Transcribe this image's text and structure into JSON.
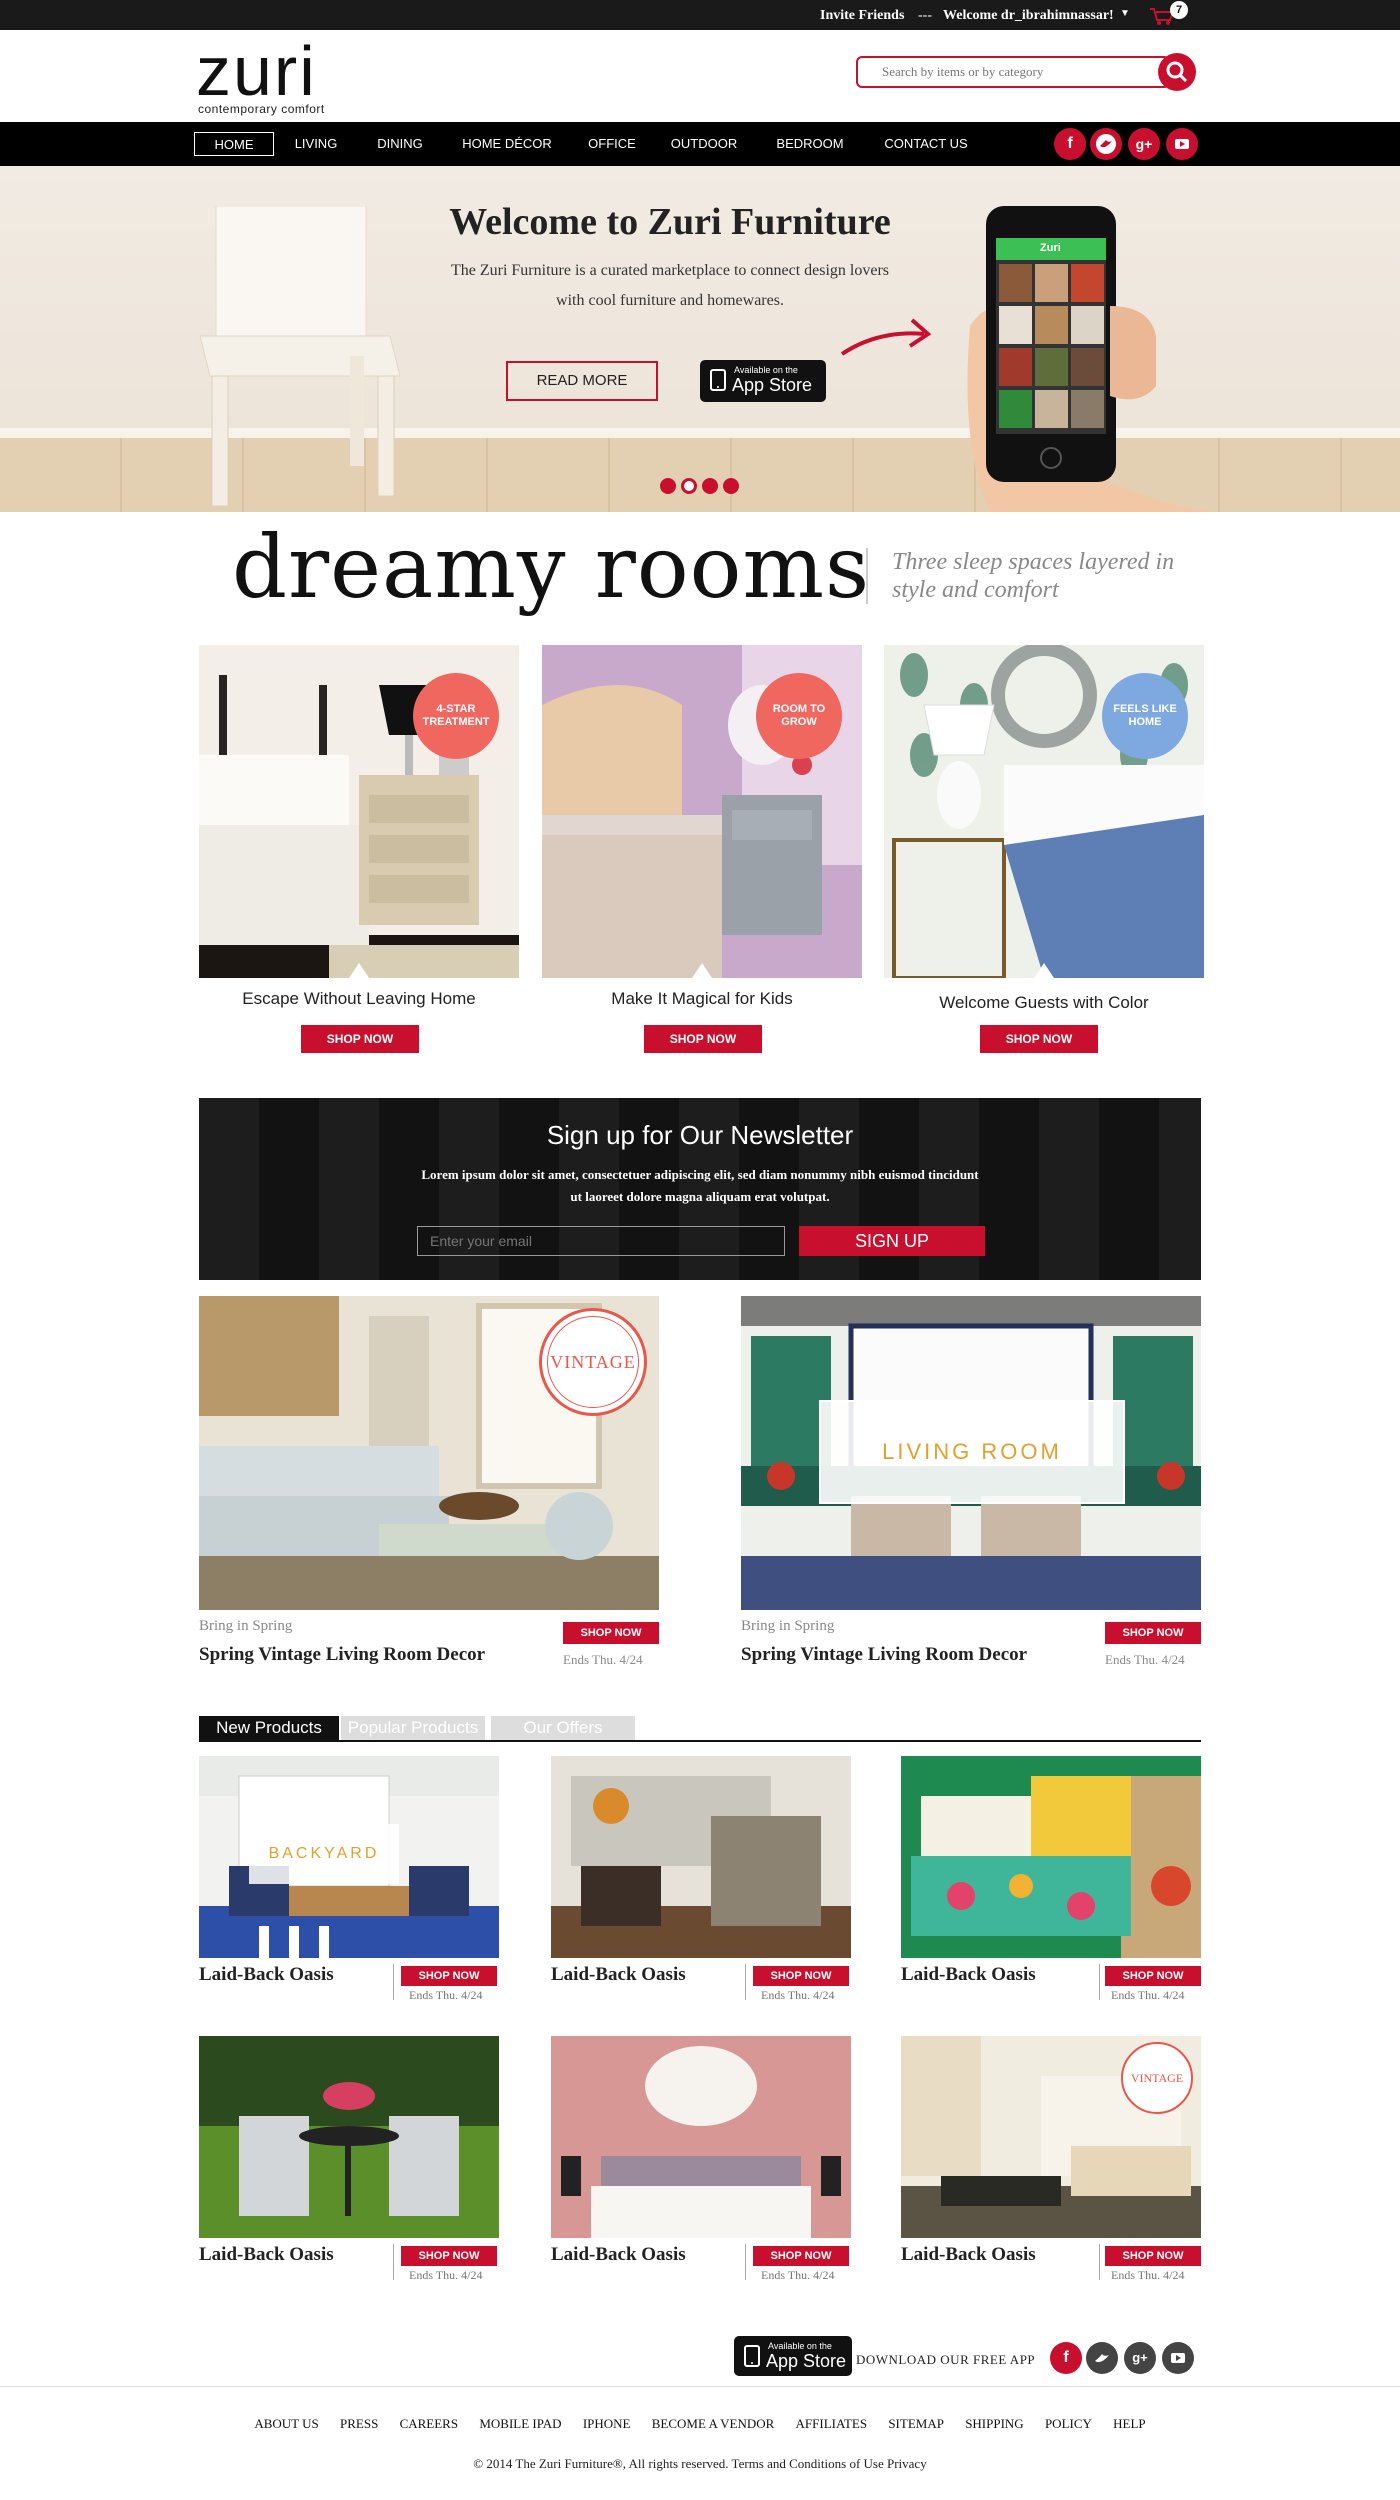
{
  "topbar": {
    "invite": "Invite Friends",
    "separator": "---",
    "welcome": "Welcome dr_ibrahimnassar!",
    "cart_count": "7"
  },
  "header": {
    "logo_word": "zuri",
    "logo_tagline": "contemporary comfort",
    "search_placeholder": "Search by items or by category"
  },
  "nav": {
    "items": [
      "HOME",
      "LIVING",
      "DINING",
      "HOME DÉCOR",
      "OFFICE",
      "OUTDOOR",
      "BEDROOM",
      "CONTACT US"
    ],
    "social": [
      "f",
      "t",
      "g+",
      "yt"
    ]
  },
  "hero": {
    "title": "Welcome to Zuri Furniture",
    "body": "The Zuri Furniture is a curated marketplace to connect design lovers with cool furniture and homewares.",
    "read_more": "READ MORE",
    "appstore_small": "Available on the",
    "appstore_big": "App Store",
    "phone_app_title": "Zuri"
  },
  "dreamy": {
    "title": "dreamy rooms",
    "subtitle": "Three sleep spaces layered in style and comfort"
  },
  "rooms": [
    {
      "badge": "4-STAR TREATMENT",
      "caption": "Escape Without Leaving Home",
      "shop": "SHOP NOW",
      "badge_color": "#f0675f"
    },
    {
      "badge": "ROOM TO GROW",
      "caption": "Make It Magical for Kids",
      "shop": "SHOP NOW",
      "badge_color": "#f0675f"
    },
    {
      "badge": "FEELS LIKE HOME",
      "caption": "Welcome Guests with Color",
      "shop": "SHOP NOW",
      "badge_color": "#7ea8e0"
    }
  ],
  "newsletter": {
    "title": "Sign up for Our Newsletter",
    "body": "Lorem ipsum dolor sit amet, consectetuer adipiscing elit, sed diam nonummy nibh euismod tincidunt ut laoreet dolore magna aliquam erat volutpat.",
    "placeholder": "Enter your email",
    "button": "SIGN UP"
  },
  "features": [
    {
      "badge": "VINTAGE",
      "kicker": "Bring in Spring",
      "title": "Spring Vintage Living Room Decor",
      "shop": "SHOP NOW",
      "ends": "Ends Thu. 4/24"
    },
    {
      "badge": "LIVING ROOM",
      "kicker": "Bring in Spring",
      "title": "Spring Vintage Living Room Decor",
      "shop": "SHOP NOW",
      "ends": "Ends Thu. 4/24"
    }
  ],
  "tabs": [
    "New Products",
    "Popular Products",
    "Our Offers"
  ],
  "products": [
    {
      "name": "Laid-Back Oasis",
      "shop": "SHOP NOW",
      "ends": "Ends Thu. 4/24",
      "overlay": "BACKYARD"
    },
    {
      "name": "Laid-Back Oasis",
      "shop": "SHOP NOW",
      "ends": "Ends Thu. 4/24"
    },
    {
      "name": "Laid-Back Oasis",
      "shop": "SHOP NOW",
      "ends": "Ends Thu. 4/24"
    },
    {
      "name": "Laid-Back Oasis",
      "shop": "SHOP NOW",
      "ends": "Ends Thu. 4/24"
    },
    {
      "name": "Laid-Back Oasis",
      "shop": "SHOP NOW",
      "ends": "Ends Thu. 4/24"
    },
    {
      "name": "Laid-Back Oasis",
      "shop": "SHOP NOW",
      "ends": "Ends Thu. 4/24",
      "overlay": "VINTAGE"
    }
  ],
  "footer": {
    "appstore_small": "Available on the",
    "appstore_big": "App Store",
    "download": "DOWNLOAD OUR FREE APP",
    "links": [
      "ABOUT US",
      "PRESS",
      "CAREERS",
      "MOBILE IPAD",
      "IPHONE",
      "BECOME A VENDOR",
      "AFFILIATES",
      "SITEMAP",
      "SHIPPING",
      "POLICY",
      "HELP"
    ],
    "copyright": "© 2014 The Zuri Furniture®, All rights reserved. Terms and Conditions of Use Privacy"
  },
  "colors": {
    "accent": "#c8102e",
    "dark": "#000000"
  }
}
